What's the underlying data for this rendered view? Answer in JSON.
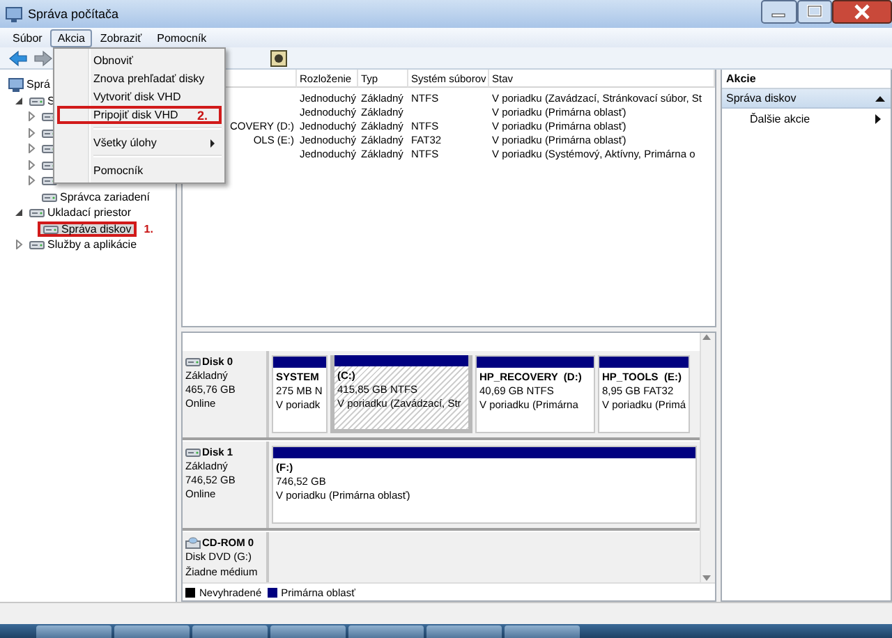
{
  "window": {
    "title": "Správa počítača"
  },
  "menu_bar": [
    {
      "label": "Súbor",
      "selected": false
    },
    {
      "label": "Akcia",
      "selected": true
    },
    {
      "label": "Zobraziť",
      "selected": false
    },
    {
      "label": "Pomocník",
      "selected": false
    }
  ],
  "open_menu": [
    {
      "kind": "item",
      "label": "Obnoviť",
      "highlighted": false
    },
    {
      "kind": "item",
      "label": "Znova prehľadať disky",
      "highlighted": false
    },
    {
      "kind": "item",
      "label": "Vytvoriť disk VHD",
      "highlighted": false
    },
    {
      "kind": "item",
      "label": "Pripojiť disk VHD",
      "highlighted": true,
      "annotation": "2."
    },
    {
      "kind": "separator"
    },
    {
      "kind": "submenu",
      "label": "Všetky úlohy",
      "highlighted": false
    },
    {
      "kind": "separator"
    },
    {
      "kind": "item",
      "label": "Pomocník",
      "highlighted": false
    }
  ],
  "tree": {
    "label": "Sprá",
    "selected": false,
    "children": [
      {
        "label": "S",
        "selected": false,
        "expanded": true,
        "children": [
          {
            "selected": false,
            "expanded": false
          },
          {
            "selected": false,
            "expanded": false
          },
          {
            "selected": false,
            "expanded": false
          },
          {
            "selected": false,
            "expanded": false
          },
          {
            "selected": false,
            "expanded": false
          },
          {
            "label": "Správca zariadení",
            "selected": false
          }
        ]
      },
      {
        "label": "Ukladací priestor",
        "selected": false,
        "expanded": true,
        "children": [
          {
            "label": "Správa diskov",
            "selected": true,
            "highlighted": true,
            "annotation": "1."
          }
        ]
      },
      {
        "label": "Služby a aplikácie",
        "selected": false,
        "expanded": false
      }
    ]
  },
  "volume_list": {
    "columns": [
      "Rozloženie",
      "Typ",
      "Systém súborov",
      "Stav"
    ],
    "rows": [
      {
        "layout": "Jednoduchý",
        "type": "Základný",
        "file_system": "NTFS",
        "status": "V poriadku (Zavádzací, Stránkovací súbor, St"
      },
      {
        "layout": "Jednoduchý",
        "type": "Základný",
        "status": "V poriadku (Primárna oblasť)"
      },
      {
        "volume": "COVERY (D:)",
        "layout": "Jednoduchý",
        "type": "Základný",
        "file_system": "NTFS",
        "status": "V poriadku (Primárna oblasť)"
      },
      {
        "volume": "OLS (E:)",
        "layout": "Jednoduchý",
        "type": "Základný",
        "file_system": "FAT32",
        "status": "V poriadku (Primárna oblasť)"
      },
      {
        "layout": "Jednoduchý",
        "type": "Základný",
        "file_system": "NTFS",
        "status": "V poriadku (Systémový, Aktívny, Primárna o"
      }
    ]
  },
  "disks": [
    {
      "kind": "disk",
      "name": "Disk 0",
      "type": "Základný",
      "size": "465,76 GB",
      "state": "Online",
      "partitions": [
        {
          "name": "SYSTEM",
          "size": "275 MB N",
          "status": "V poriadk",
          "selected": false
        },
        {
          "name": "(C:)",
          "size": "415,85 GB NTFS",
          "status": "V poriadku (Zavádzací, Str",
          "selected": true
        },
        {
          "name": "HP_RECOVERY  (D:)",
          "size": "40,69 GB NTFS",
          "status": "V poriadku (Primárna",
          "selected": false
        },
        {
          "name": "HP_TOOLS  (E:)",
          "size": "8,95 GB FAT32",
          "status": "V poriadku (Primá",
          "selected": false
        }
      ]
    },
    {
      "kind": "disk",
      "name": "Disk 1",
      "type": "Základný",
      "size": "746,52 GB",
      "state": "Online",
      "partitions": [
        {
          "name": "(F:)",
          "size": "746,52 GB",
          "status": "V poriadku (Primárna oblasť)",
          "selected": false
        }
      ]
    },
    {
      "kind": "cdrom",
      "name": "CD-ROM 0",
      "type": "Disk DVD (G:)",
      "state": "Žiadne médium"
    }
  ],
  "legend": [
    {
      "label": "Nevyhradené",
      "color": "#000000"
    },
    {
      "label": "Primárna oblasť",
      "color": "#000080"
    }
  ],
  "actions": {
    "title": "Akcie",
    "sections": [
      {
        "label": "Správa diskov",
        "expanded": true,
        "items": [
          {
            "label": "Ďalšie akcie"
          }
        ]
      }
    ]
  }
}
